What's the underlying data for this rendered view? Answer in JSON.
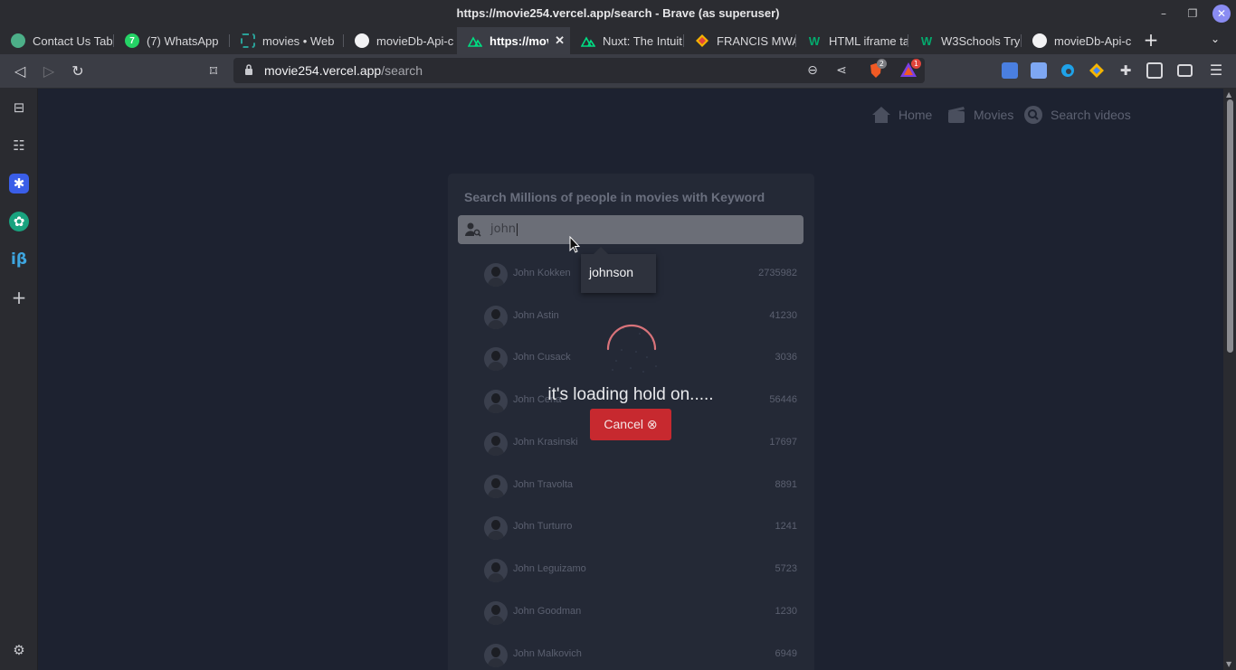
{
  "window": {
    "title": "https://movie254.vercel.app/search - Brave (as superuser)",
    "minimize_glyph": "–",
    "restore_glyph": "❐",
    "close_glyph": "✕"
  },
  "tabs": [
    {
      "label": "Contact Us Tab",
      "icon": "tab-favicon",
      "color": "#4caf88"
    },
    {
      "label": "(7) WhatsApp",
      "icon": "whatsapp-icon",
      "color": "#25d366",
      "badge": "7"
    },
    {
      "label": "movies • Web",
      "icon": "web-icon",
      "color": "#2aa198"
    },
    {
      "label": "movieDb-Api-c",
      "icon": "github-icon",
      "color": "#ffffff"
    },
    {
      "label": "https://mov",
      "icon": "nuxt-icon",
      "color": "#00dc82",
      "active": true,
      "close": "✕"
    },
    {
      "label": "Nuxt: The Intuit",
      "icon": "nuxt-icon",
      "color": "#00dc82"
    },
    {
      "label": "FRANCIS MWA",
      "icon": "diamond-icon",
      "color": "#f4b400"
    },
    {
      "label": "HTML iframe ta",
      "icon": "w3schools-icon",
      "color": "#04aa6d"
    },
    {
      "label": "W3Schools Try",
      "icon": "w3schools-icon",
      "color": "#04aa6d"
    },
    {
      "label": "movieDb-Api-c",
      "icon": "github-icon",
      "color": "#ffffff"
    }
  ],
  "toolbar": {
    "new_tab_glyph": "+",
    "tab_list_glyph": "⌄",
    "back_glyph": "◁",
    "forward_glyph": "▷",
    "reload_glyph": "↻",
    "bookmark_glyph": "⌑",
    "url_host": "movie254.vercel.app",
    "url_path": "/search",
    "zoom_glyph": "⊖",
    "share_glyph": "⋖",
    "shield_count": "2",
    "rewards_count": "1",
    "menu_glyph": "☰"
  },
  "sidebar": {
    "items": [
      {
        "icon": "bookmarks-icon",
        "glyph": "⊟"
      },
      {
        "icon": "reading-list-icon",
        "glyph": "☷"
      },
      {
        "icon": "app-icon",
        "glyph": "✱"
      },
      {
        "icon": "chatgpt-icon",
        "glyph": "✿"
      },
      {
        "icon": "ib-icon",
        "glyph": "iβ"
      },
      {
        "icon": "add-icon",
        "glyph": "+"
      }
    ],
    "settings_glyph": "⚙"
  },
  "site_nav": [
    {
      "label": "Home",
      "icon": "home-icon"
    },
    {
      "label": "Movies",
      "icon": "movies-icon"
    },
    {
      "label": "Search videos",
      "icon": "search-icon"
    }
  ],
  "search": {
    "heading": "Search Millions of people in movies with Keyword",
    "value": "john",
    "suggestion": "johnson"
  },
  "results": [
    {
      "name": "John Kokken",
      "id": "2735982"
    },
    {
      "name": "John Astin",
      "id": "41230"
    },
    {
      "name": "John Cusack",
      "id": "3036"
    },
    {
      "name": "John Cena",
      "id": "56446"
    },
    {
      "name": "John Krasinski",
      "id": "17697"
    },
    {
      "name": "John Travolta",
      "id": "8891"
    },
    {
      "name": "John Turturro",
      "id": "1241"
    },
    {
      "name": "John Leguizamo",
      "id": "5723"
    },
    {
      "name": "John Goodman",
      "id": "1230"
    },
    {
      "name": "John Malkovich",
      "id": "6949"
    }
  ],
  "loading": {
    "text": "it's loading hold on.....",
    "cancel_label": "Cancel ⊗"
  },
  "colors": {
    "page_bg": "#1d2230",
    "panel_bg": "#242936",
    "cancel_bg": "#c7292f",
    "spinner": "#d9737a"
  }
}
